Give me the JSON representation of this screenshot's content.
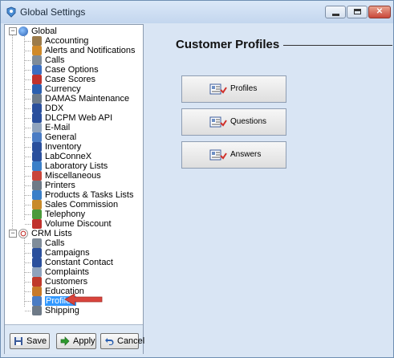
{
  "window": {
    "title": "Global Settings"
  },
  "tree": {
    "global": "Global",
    "global_items": [
      {
        "label": "Accounting",
        "icon": "accounting-icon",
        "color": "#9c7b4a"
      },
      {
        "label": "Alerts and Notifications",
        "icon": "alert-icon",
        "color": "#d08a2a"
      },
      {
        "label": "Calls",
        "icon": "calls-icon",
        "color": "#7f8c99"
      },
      {
        "label": "Case Options",
        "icon": "case-options-icon",
        "color": "#3a6fc2"
      },
      {
        "label": "Case Scores",
        "icon": "case-scores-icon",
        "color": "#c0312c"
      },
      {
        "label": "Currency",
        "icon": "currency-icon",
        "color": "#2a5fb0"
      },
      {
        "label": "DAMAS Maintenance",
        "icon": "maintenance-icon",
        "color": "#6d7b8a"
      },
      {
        "label": "DDX",
        "icon": "ddx-icon",
        "color": "#2a4f9c"
      },
      {
        "label": "DLCPM Web API",
        "icon": "web-api-icon",
        "color": "#2a4f9c"
      },
      {
        "label": "E-Mail",
        "icon": "email-icon",
        "color": "#8fa3bd"
      },
      {
        "label": "General",
        "icon": "general-icon",
        "color": "#4a7cc4"
      },
      {
        "label": "Inventory",
        "icon": "inventory-icon",
        "color": "#2a4f9c"
      },
      {
        "label": "LabConneX",
        "icon": "labconnex-icon",
        "color": "#2a4f9c"
      },
      {
        "label": "Laboratory Lists",
        "icon": "lab-lists-icon",
        "color": "#3b7fc8"
      },
      {
        "label": "Miscellaneous",
        "icon": "misc-icon",
        "color": "#c9453a"
      },
      {
        "label": "Printers",
        "icon": "printer-icon",
        "color": "#6e7a87"
      },
      {
        "label": "Products & Tasks Lists",
        "icon": "products-icon",
        "color": "#3b7fc8"
      },
      {
        "label": "Sales Commission",
        "icon": "sales-commission-icon",
        "color": "#c88a2a"
      },
      {
        "label": "Telephony",
        "icon": "telephony-icon",
        "color": "#4a9a3a"
      },
      {
        "label": "Volume Discount",
        "icon": "percent-icon",
        "color": "#c0312c"
      }
    ],
    "crm": "CRM Lists",
    "crm_items": [
      {
        "label": "Calls",
        "icon": "calls-icon",
        "color": "#7f8c99"
      },
      {
        "label": "Campaigns",
        "icon": "campaigns-icon",
        "color": "#2a4f9c"
      },
      {
        "label": "Constant Contact",
        "icon": "constant-contact-icon",
        "color": "#2a4f9c"
      },
      {
        "label": "Complaints",
        "icon": "complaints-icon",
        "color": "#8fa3bd"
      },
      {
        "label": "Customers",
        "icon": "customers-icon",
        "color": "#c0392b"
      },
      {
        "label": "Education",
        "icon": "education-icon",
        "color": "#c87a2a"
      },
      {
        "label": "Profiles",
        "icon": "profiles-icon",
        "color": "#4a7cc4",
        "selected": true
      },
      {
        "label": "Shipping",
        "icon": "shipping-icon",
        "color": "#6e7a87"
      }
    ]
  },
  "buttons": {
    "save": "Save",
    "apply": "Apply",
    "cancel": "Cancel"
  },
  "main": {
    "title": "Customer Profiles",
    "tiles": [
      "Profiles",
      "Questions",
      "Answers"
    ]
  },
  "colors": {
    "selection": "#3399ff",
    "arrow": "#d9443c",
    "panel": "#d9e5f4"
  }
}
